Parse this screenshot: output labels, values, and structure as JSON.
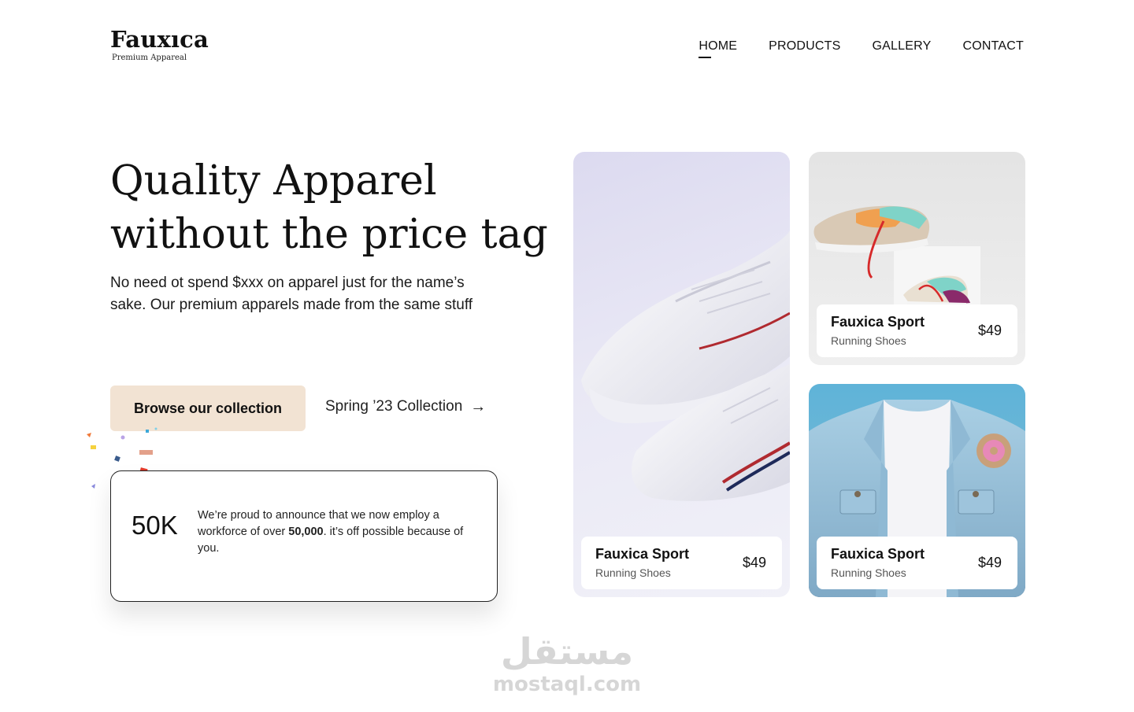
{
  "brand": {
    "name": "Fauxıca",
    "tagline": "Premium Appareal"
  },
  "nav": {
    "items": [
      {
        "label": "HOME",
        "active": true
      },
      {
        "label": "PRODUCTS",
        "active": false
      },
      {
        "label": "GALLERY",
        "active": false
      },
      {
        "label": "CONTACT",
        "active": false
      }
    ]
  },
  "hero": {
    "title_line1": "Quality Apparel",
    "title_line2": "without the price tag",
    "description": "No need ot spend $xxx on apparel just for the name’s sake. Our premium apparels made from the same stuff",
    "primary_button": "Browse our collection",
    "secondary_link": "Spring ’23 Collection",
    "secondary_icon": "arrow-right-icon"
  },
  "stat": {
    "number": "50K",
    "text_before": "We’re proud to announce that we now employ a workforce of over ",
    "text_bold": "50,000",
    "text_after": ". it’s off possible  because of you."
  },
  "products": [
    {
      "title": "Fauxica Sport",
      "subtitle": "Running Shoes",
      "price": "$49"
    },
    {
      "title": "Fauxica Sport",
      "subtitle": "Running Shoes",
      "price": "$49"
    },
    {
      "title": "Fauxica Sport",
      "subtitle": "Running Shoes",
      "price": "$49"
    }
  ],
  "watermark": {
    "arabic": "مستقل",
    "latin": "mostaql.com"
  },
  "colors": {
    "button_bg": "#f2e3d3",
    "text": "#111111"
  }
}
